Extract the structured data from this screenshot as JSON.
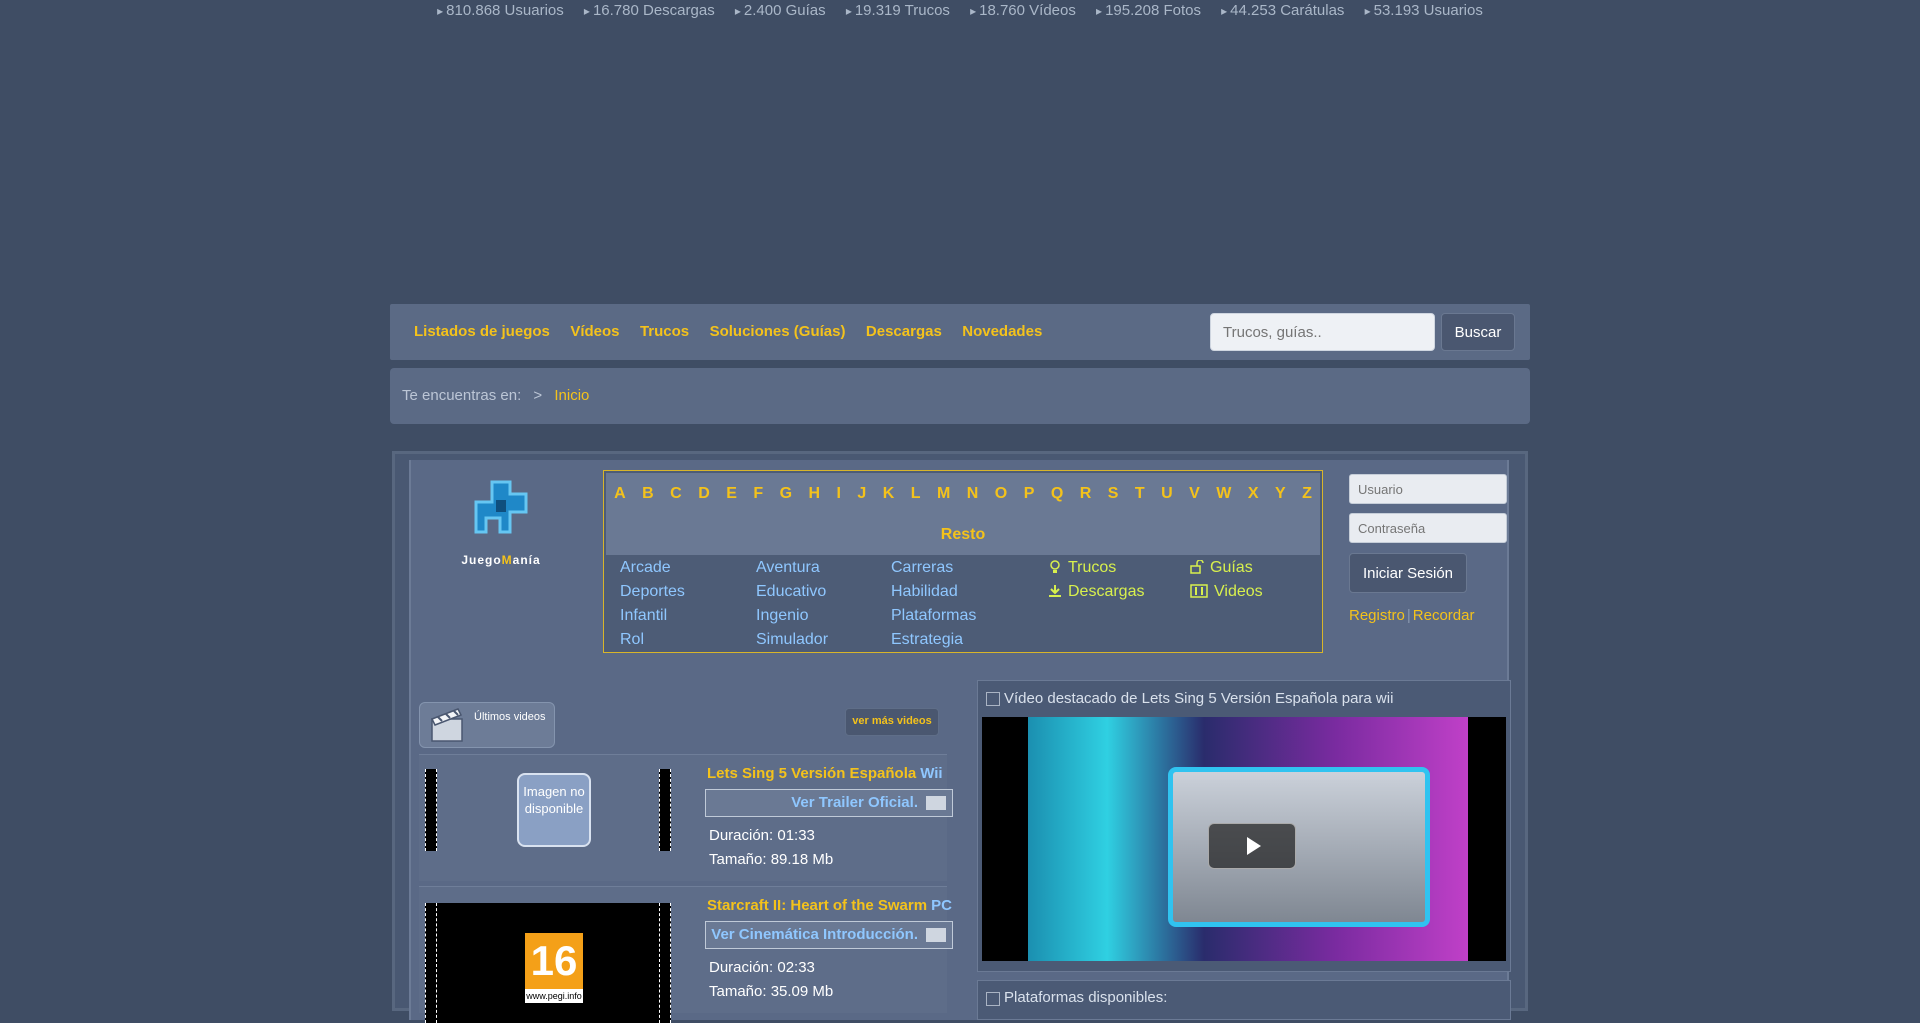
{
  "stats": [
    "810.868 Usuarios",
    "16.780 Descargas",
    "2.400 Guías",
    "19.319 Trucos",
    "18.760 Vídeos",
    "195.208 Fotos",
    "44.253 Carátulas",
    "53.193 Usuarios"
  ],
  "nav": {
    "links": [
      "Listados de juegos",
      "Vídeos",
      "Trucos",
      "Soluciones (Guías)",
      "Descargas",
      "Novedades"
    ],
    "search_placeholder": "Trucos, guías..",
    "search_button": "Buscar"
  },
  "breadcrumb": {
    "label": "Te encuentras en:",
    "separator": ">",
    "home": "Inicio"
  },
  "logo": {
    "text_a": "Juego",
    "text_b": "M",
    "text_c": "anía"
  },
  "alphabet": {
    "letters": [
      "A",
      "B",
      "C",
      "D",
      "E",
      "F",
      "G",
      "H",
      "I",
      "J",
      "K",
      "L",
      "M",
      "N",
      "O",
      "P",
      "Q",
      "R",
      "S",
      "T",
      "U",
      "V",
      "W",
      "X",
      "Y",
      "Z"
    ],
    "rest": "Resto"
  },
  "genres": [
    "Arcade",
    "Aventura",
    "Carreras",
    "Deportes",
    "Educativo",
    "Habilidad",
    "Infantil",
    "Ingenio",
    "Plataformas",
    "Rol",
    "Simulador",
    "Estrategia"
  ],
  "quick_links": [
    {
      "label": "Trucos",
      "icon": "lightbulb-icon"
    },
    {
      "label": "Guías",
      "icon": "unlock-icon"
    },
    {
      "label": "Descargas",
      "icon": "download-icon"
    },
    {
      "label": "Videos",
      "icon": "film-icon"
    }
  ],
  "login": {
    "user_placeholder": "Usuario",
    "pass_placeholder": "Contraseña",
    "button": "Iniciar Sesión",
    "register": "Registro",
    "separator": "|",
    "remember": "Recordar"
  },
  "latest_videos": {
    "tab_label": "Últimos videos",
    "more": "ver más videos",
    "items": [
      {
        "game": "Lets Sing 5 Versión Española",
        "platform": "Wii",
        "link": "Ver Trailer Oficial.",
        "duration": "Duración: 01:33",
        "size": "Tamaño: 89.18 Mb",
        "thumb_text": "Imagen no disponible"
      },
      {
        "game": "Starcraft II: Heart of the Swarm",
        "platform": "PC",
        "link": "Ver Cinemática Introducción.",
        "duration": "Duración: 02:33",
        "size": "Tamaño: 35.09 Mb",
        "pegi": "16",
        "pegi_site": "www.pegi.info"
      }
    ]
  },
  "featured": {
    "title": "Vídeo destacado de Lets Sing 5 Versión Española para wii"
  },
  "platforms": {
    "title": "Plataformas disponibles:"
  }
}
